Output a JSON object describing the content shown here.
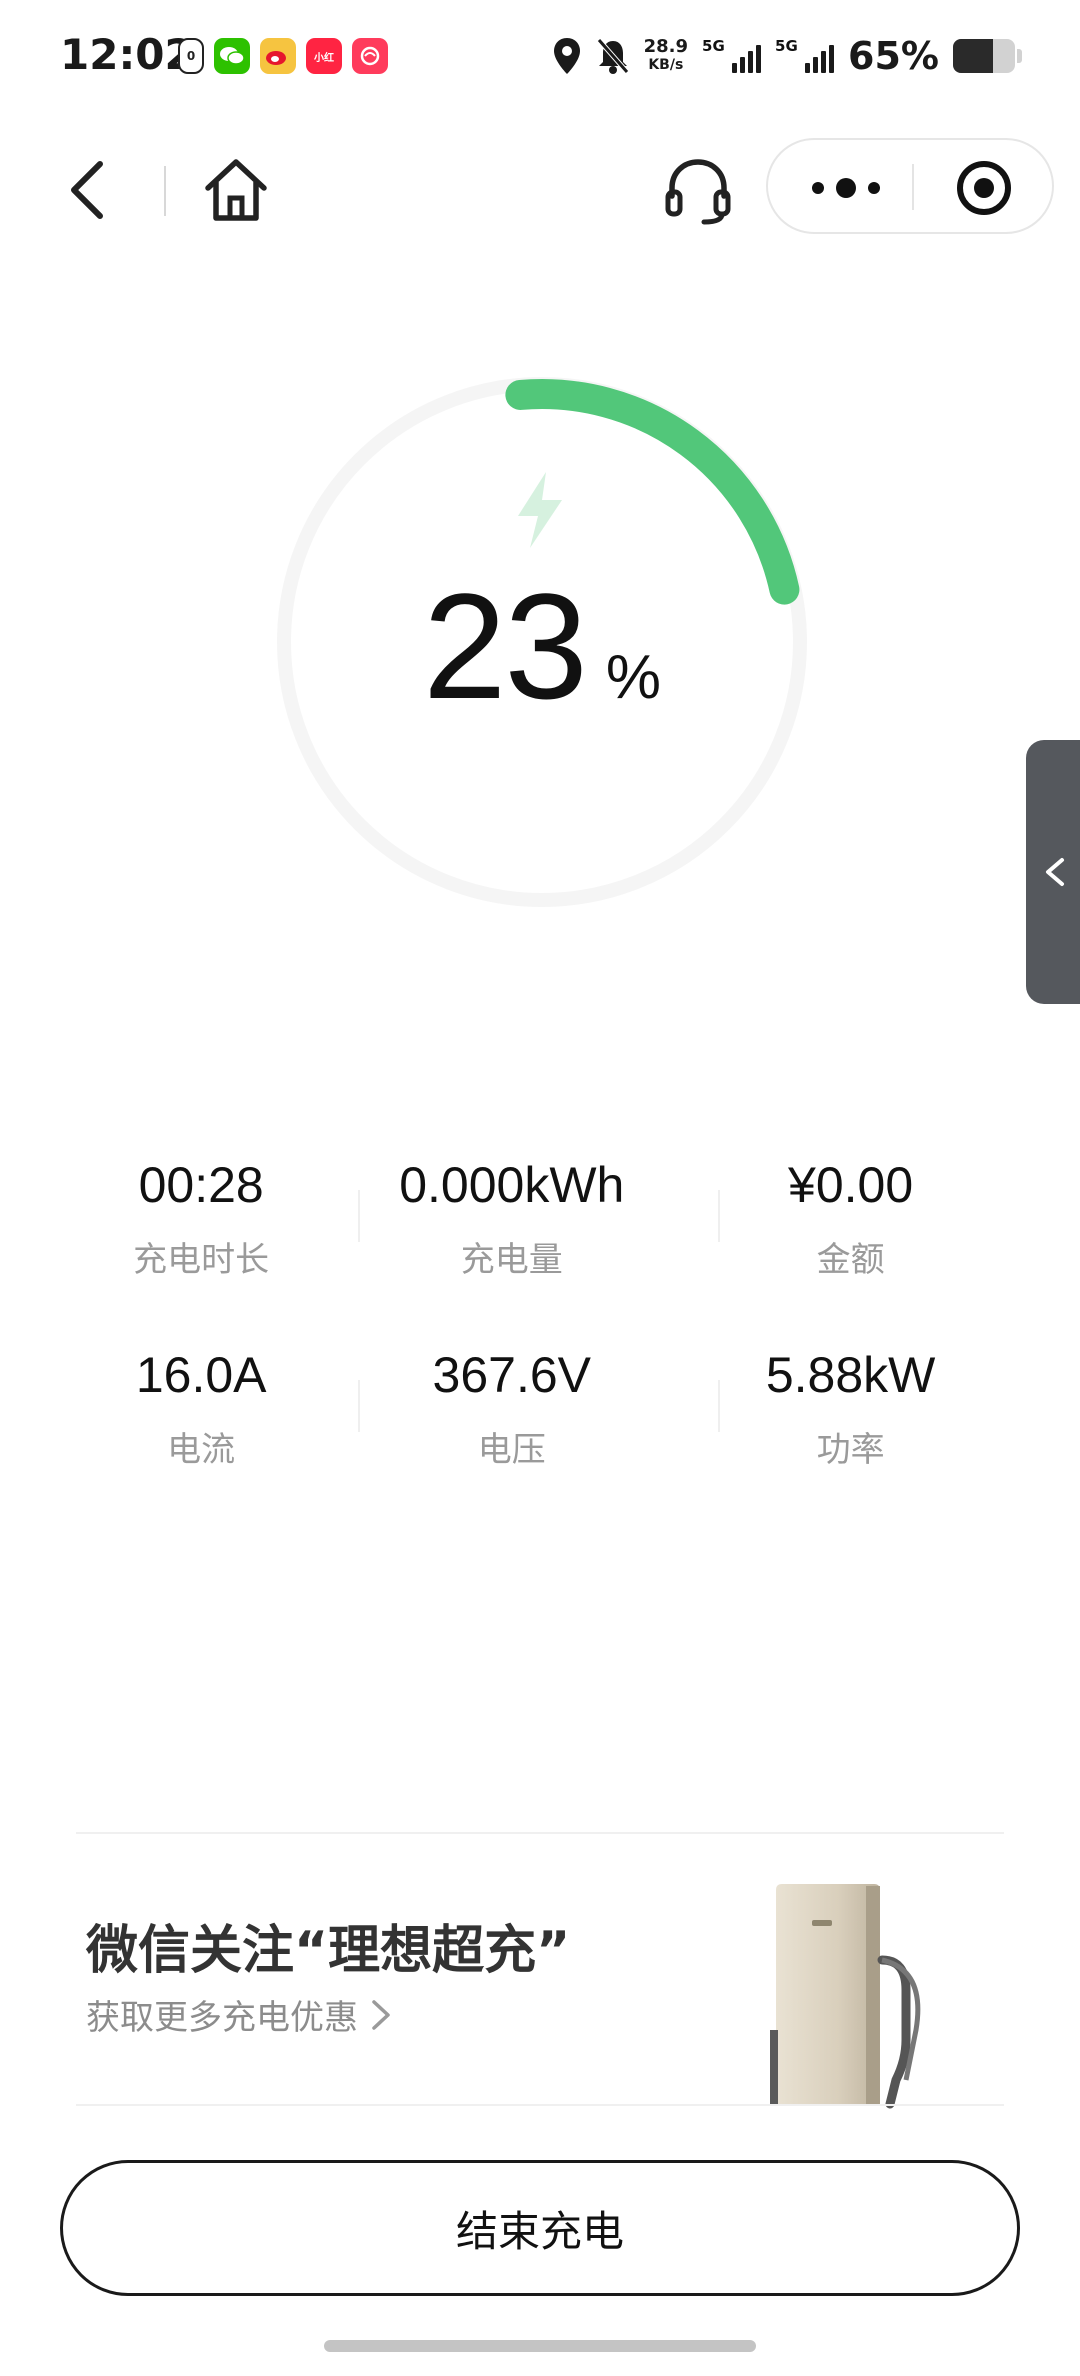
{
  "status_bar": {
    "time": "12:02",
    "net_speed_value": "28.9",
    "net_speed_unit": "KB/s",
    "sim1_tag": "5G",
    "sim2_tag": "5G",
    "battery_pct": "65%",
    "battery_level": 0.65
  },
  "nav": {
    "back_icon": "chevron-left-icon",
    "home_icon": "home-icon",
    "service_icon": "headset-icon",
    "more_icon": "more-dots-icon",
    "close_icon": "target-close-icon"
  },
  "gauge": {
    "value": "23",
    "unit": "%",
    "progress": 0.23,
    "accent_color": "#52c77a",
    "track_color": "#f5f5f5"
  },
  "metrics": [
    {
      "value": "00:28",
      "label": "充电时长"
    },
    {
      "value": "0.000kWh",
      "label": "充电量"
    },
    {
      "value": "¥0.00",
      "label": "金额"
    },
    {
      "value": "16.0A",
      "label": "电流"
    },
    {
      "value": "367.6V",
      "label": "电压"
    },
    {
      "value": "5.88kW",
      "label": "功率"
    }
  ],
  "promo": {
    "title": "微信关注“理想超充”",
    "subtitle": "获取更多充电优惠"
  },
  "end_button": {
    "label": "结束充电"
  }
}
